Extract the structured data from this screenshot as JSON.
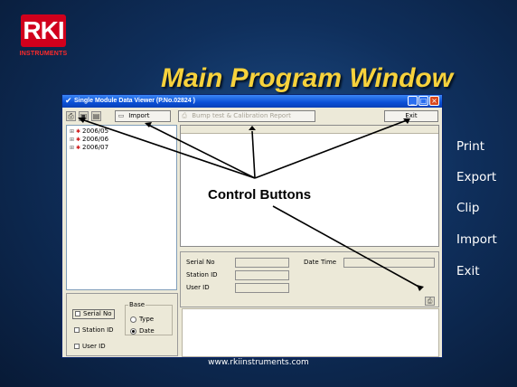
{
  "logo": {
    "letters": "RKI",
    "subtitle": "INSTRUMENTS"
  },
  "slide": {
    "title": "Main Program Window",
    "footer": "www.rkiinstruments.com"
  },
  "window": {
    "title": "Single Module Data Viewer (P.No.02824 )",
    "controls": {
      "minimize": "_",
      "maximize": "□",
      "close": "×"
    }
  },
  "toolbar": {
    "import_label": "Import",
    "bump_label": "Bump test & Calibration Report",
    "exit_label": "Exit",
    "icons": [
      "print-icon",
      "save-icon",
      "clipboard-icon",
      "import-icon",
      "report-icon"
    ]
  },
  "tree": {
    "items": [
      "2006/05",
      "2006/06",
      "2006/07"
    ]
  },
  "info": {
    "serial_no_label": "Serial No",
    "station_id_label": "Station ID",
    "user_id_label": "User ID",
    "date_time_label": "Date Time"
  },
  "filters": {
    "serial_no": "Serial No",
    "station_id": "Station ID",
    "user_id": "User ID",
    "base_label": "Base",
    "type": "Type",
    "date": "Date",
    "selected_base": "Date"
  },
  "callout": {
    "label": "Control Buttons"
  },
  "side_list": [
    "Print",
    "Export",
    "Clip",
    "Import",
    "Exit"
  ],
  "colors": {
    "title": "#f7d23c",
    "logo_red": "#d1001c",
    "titlebar": "#0a4fd6"
  }
}
